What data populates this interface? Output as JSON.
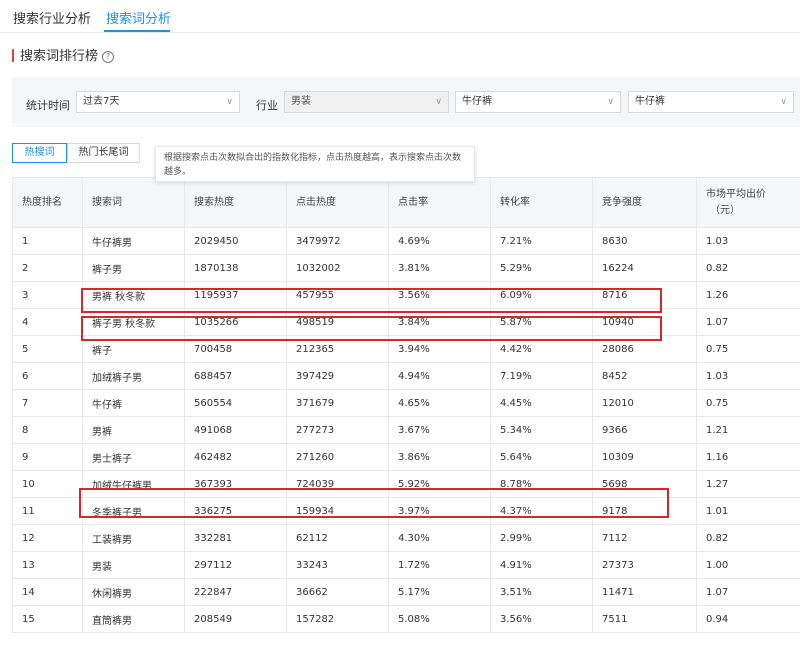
{
  "tabs": [
    "搜索行业分析",
    "搜索词分析"
  ],
  "active_tab": "搜索词分析",
  "section": {
    "title": "搜索词排行榜",
    "help_icon": "question-circle-icon"
  },
  "filters": {
    "period_label": "统计时间",
    "period_value": "过去7天",
    "industry_label": "行业",
    "industry_value": "男装",
    "category1_value": "牛仔裤",
    "category2_value": "牛仔裤"
  },
  "subtabs": [
    "热搜词",
    "热门长尾词"
  ],
  "active_subtab": "热搜词",
  "tooltip": "根据搜索点击次数拟合出的指数化指标，点击热度越高，表示搜索点击次数越多。",
  "table": {
    "headers": [
      "热度排名",
      "搜索词",
      "搜索热度",
      "点击热度",
      "点击率",
      "转化率",
      "竞争强度",
      "市场平均出价",
      "（元）"
    ],
    "rows": [
      [
        "1",
        "牛仔裤男",
        "2029450",
        "3479972",
        "4.69%",
        "7.21%",
        "8630",
        "1.03"
      ],
      [
        "2",
        "裤子男",
        "1870138",
        "1032002",
        "3.81%",
        "5.29%",
        "16224",
        "0.82"
      ],
      [
        "3",
        "男裤 秋冬款",
        "1195937",
        "457955",
        "3.56%",
        "6.09%",
        "8716",
        "1.26"
      ],
      [
        "4",
        "裤子男 秋冬款",
        "1035266",
        "498519",
        "3.84%",
        "5.87%",
        "10940",
        "1.07"
      ],
      [
        "5",
        "裤子",
        "700458",
        "212365",
        "3.94%",
        "4.42%",
        "28086",
        "0.75"
      ],
      [
        "6",
        "加绒裤子男",
        "688457",
        "397429",
        "4.94%",
        "7.19%",
        "8452",
        "1.03"
      ],
      [
        "7",
        "牛仔裤",
        "560554",
        "371679",
        "4.65%",
        "4.45%",
        "12010",
        "0.75"
      ],
      [
        "8",
        "男裤",
        "491068",
        "277273",
        "3.67%",
        "5.34%",
        "9366",
        "1.21"
      ],
      [
        "9",
        "男士裤子",
        "462482",
        "271260",
        "3.86%",
        "5.64%",
        "10309",
        "1.16"
      ],
      [
        "10",
        "加绒牛仔裤男",
        "367393",
        "724039",
        "5.92%",
        "8.78%",
        "5698",
        "1.27"
      ],
      [
        "11",
        "冬季裤子男",
        "336275",
        "159934",
        "3.97%",
        "4.37%",
        "9178",
        "1.01"
      ],
      [
        "12",
        "工装裤男",
        "332281",
        "62112",
        "4.30%",
        "2.99%",
        "7112",
        "0.82"
      ],
      [
        "13",
        "男装",
        "297112",
        "33243",
        "1.72%",
        "4.91%",
        "27373",
        "1.00"
      ],
      [
        "14",
        "休闲裤男",
        "222847",
        "36662",
        "5.17%",
        "3.51%",
        "11471",
        "1.07"
      ],
      [
        "15",
        "直筒裤男",
        "208549",
        "157282",
        "5.08%",
        "3.56%",
        "7511",
        "0.94"
      ]
    ],
    "highlighted_ranks": [
      "3",
      "4",
      "10"
    ]
  },
  "colors": {
    "accent": "#1f8fe8",
    "highlight": "#d9262c",
    "header_bg": "#f5f6f8"
  }
}
